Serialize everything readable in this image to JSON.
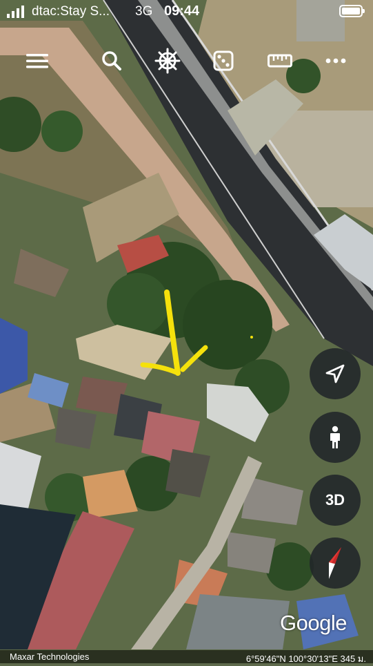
{
  "status_bar": {
    "carrier": "dtac:Stay S...",
    "network": "3G",
    "time": "09:44"
  },
  "toolbar": {
    "items": [
      "menu-icon",
      "search-icon",
      "voyager-wheel-icon",
      "dice-icon",
      "ruler-icon",
      "more-icon"
    ]
  },
  "map_controls": {
    "locate_icon": "navigation-arrow-icon",
    "street_view_icon": "pegman-icon",
    "view_mode_label": "3D",
    "compass_icon": "compass-icon"
  },
  "branding": {
    "logo_text": "Google"
  },
  "footer": {
    "attribution": "Maxar Technologies",
    "coordinates": "6°59'46\"N 100°30'13\"E 345 ม."
  },
  "colors": {
    "annotation": "#f5e10c",
    "control_bg": "#212529",
    "compass_red": "#e53935"
  }
}
